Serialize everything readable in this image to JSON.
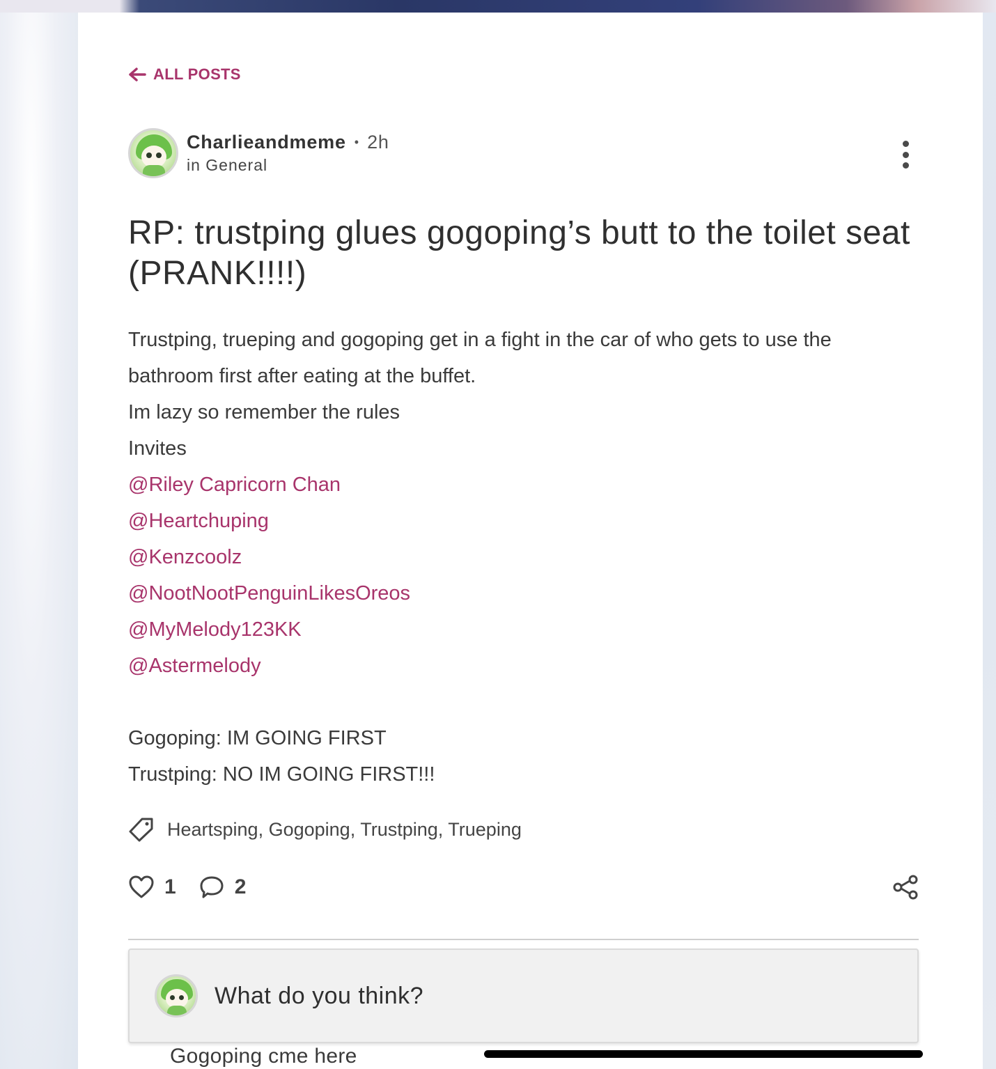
{
  "nav": {
    "back_label": "ALL POSTS"
  },
  "post": {
    "author": "Charlieandmeme",
    "time": "2h",
    "category": "in General",
    "title": "RP: trustping glues gogoping’s butt to the toilet seat (PRANK!!!!)",
    "body_intro": [
      "Trustping, trueping and gogoping get in a fight in the car of who gets to use the bathroom first after eating at the buffet.",
      "Im lazy so remember the rules",
      "Invites"
    ],
    "mentions": [
      "@Riley Capricorn Chan",
      "@Heartchuping",
      "@Kenzcoolz",
      "@NootNootPenguinLikesOreos",
      "@MyMelody123KK",
      "@Astermelody"
    ],
    "body_dialogue": [
      "Gogoping: IM GOING FIRST",
      "Trustping: NO IM GOING FIRST!!!"
    ],
    "tags": [
      "Heartsping,",
      "Gogoping,",
      "Trustping,",
      "Trueping"
    ]
  },
  "stats": {
    "likes": "1",
    "comments": "2"
  },
  "comment": {
    "placeholder": "What do you think?"
  },
  "peek_text": "Gogoping cme here",
  "colors": {
    "accent": "#a8346b",
    "text": "#3a3a3a",
    "card": "#ffffff"
  },
  "icons": [
    "arrow-left-icon",
    "more-vertical-icon",
    "tag-icon",
    "heart-icon",
    "comment-icon",
    "share-icon"
  ]
}
